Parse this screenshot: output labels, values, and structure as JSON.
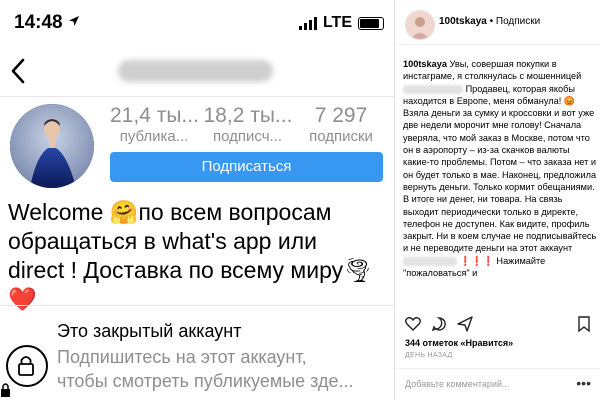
{
  "status_bar": {
    "time": "14:48",
    "carrier": "LTE"
  },
  "profile": {
    "username_blurred": "espresso_paris",
    "stats": [
      {
        "value": "21,4 ты...",
        "label": "публика..."
      },
      {
        "value": "18,2 ты...",
        "label": "подписч..."
      },
      {
        "value": "7 297",
        "label": "подписки"
      }
    ],
    "subscribe_label": "Подписаться",
    "bio_line1": "Welcome 🤗по всем вопросам",
    "bio_line2": "обращаться в what's app или",
    "bio_line3": "direct ! Доставка по всему миру🌪",
    "bio_line4": "❤️",
    "private_title": "Это закрытый аккаунт",
    "private_line1": "Подпишитесь на этот аккаунт,",
    "private_line2": "чтобы смотреть публикуемые зде..."
  },
  "post": {
    "header_user": "100tskaya",
    "header_follow": "• Подписки",
    "caption_user": "100tskaya",
    "caption_part1": "Увы, совершая покупки в инстаграме, я столкнулась с мошенницей",
    "caption_part2": "Продавец, которая якобы находится в Европе, меня обманула! 😡Взяла деньги за сумку и кроссовки и вот уже две недели морочит мне голову! Сначала уверяла, что мой заказ в Москве, потом что он в аэропорту – из-за скачков валюты какие-то проблемы. Потом – что заказа нет и он будет только в мае. Наконец, предложила вернуть деньги. Только кормит обещаниями. В итоге ни денег, ни товара. На связь выходит периодически только в директе, телефон не доступен. Как видите, профиль закрыт. Ни в коем случае не подписывайтесь и не переводите деньги на этот аккаунт",
    "caption_part3": "❗️❗️❗️ Нажимайте \"пожаловаться\" и",
    "likes": "344 отметок «Нравится»",
    "time_ago": "ДЕНЬ НАЗАД",
    "comment_placeholder": "Добавьте комментарий...",
    "more": "•••"
  },
  "colors": {
    "accent": "#3897f0",
    "muted": "#8e8e8e"
  },
  "icons": [
    "location-arrow-icon",
    "signal-bars-icon",
    "battery-icon",
    "back-chevron-icon",
    "lock-icon",
    "heart-icon",
    "comment-icon",
    "share-icon",
    "bookmark-icon"
  ]
}
